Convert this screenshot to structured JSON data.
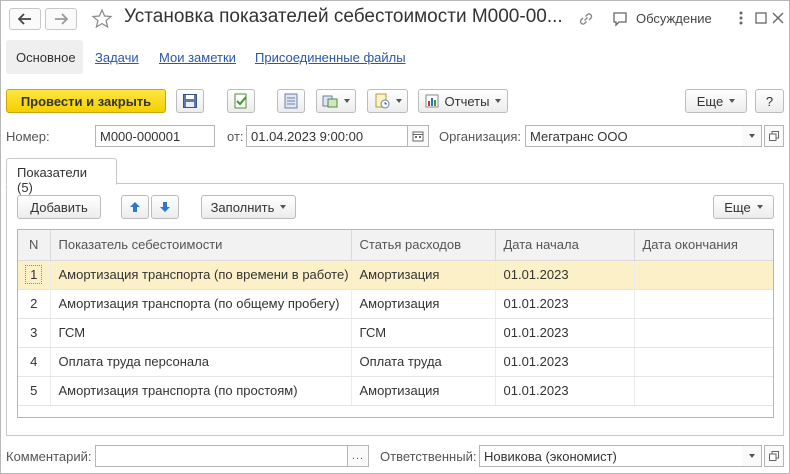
{
  "header": {
    "title": "Установка показателей себестоимости М000-00...",
    "discussion_label": "Обсуждение"
  },
  "tabs": [
    {
      "label": "Основное"
    },
    {
      "label": "Задачи"
    },
    {
      "label": "Мои заметки"
    },
    {
      "label": "Присоединенные файлы"
    }
  ],
  "toolbar": {
    "post_close_label": "Провести и закрыть",
    "reports_label": "Отчеты",
    "more_label": "Еще",
    "help_label": "?"
  },
  "fields": {
    "number_label": "Номер:",
    "number_value": "М000-000001",
    "from_label": "от:",
    "date_value": "01.04.2023  9:00:00",
    "org_label": "Организация:",
    "org_value": "Мегатранс ООО"
  },
  "inner_tab": {
    "label": "Показатели (5)"
  },
  "table_toolbar": {
    "add_label": "Добавить",
    "fill_label": "Заполнить",
    "more_label": "Еще"
  },
  "table": {
    "columns": [
      "N",
      "Показатель себестоимости",
      "Статья расходов",
      "Дата начала",
      "Дата окончания"
    ],
    "rows": [
      {
        "n": "1",
        "indicator": "Амортизация транспорта (по времени в работе)",
        "article": "Амортизация",
        "start": "01.01.2023",
        "end": ""
      },
      {
        "n": "2",
        "indicator": "Амортизация транспорта (по общему пробегу)",
        "article": "Амортизация",
        "start": "01.01.2023",
        "end": ""
      },
      {
        "n": "3",
        "indicator": "ГСМ",
        "article": "ГСМ",
        "start": "01.01.2023",
        "end": ""
      },
      {
        "n": "4",
        "indicator": "Оплата труда персонала",
        "article": "Оплата труда",
        "start": "01.01.2023",
        "end": ""
      },
      {
        "n": "5",
        "indicator": "Амортизация транспорта (по простоям)",
        "article": "Амортизация",
        "start": "01.01.2023",
        "end": ""
      }
    ]
  },
  "footer": {
    "comment_label": "Комментарий:",
    "comment_value": "",
    "responsible_label": "Ответственный:",
    "responsible_value": "Новикова (экономист)"
  }
}
